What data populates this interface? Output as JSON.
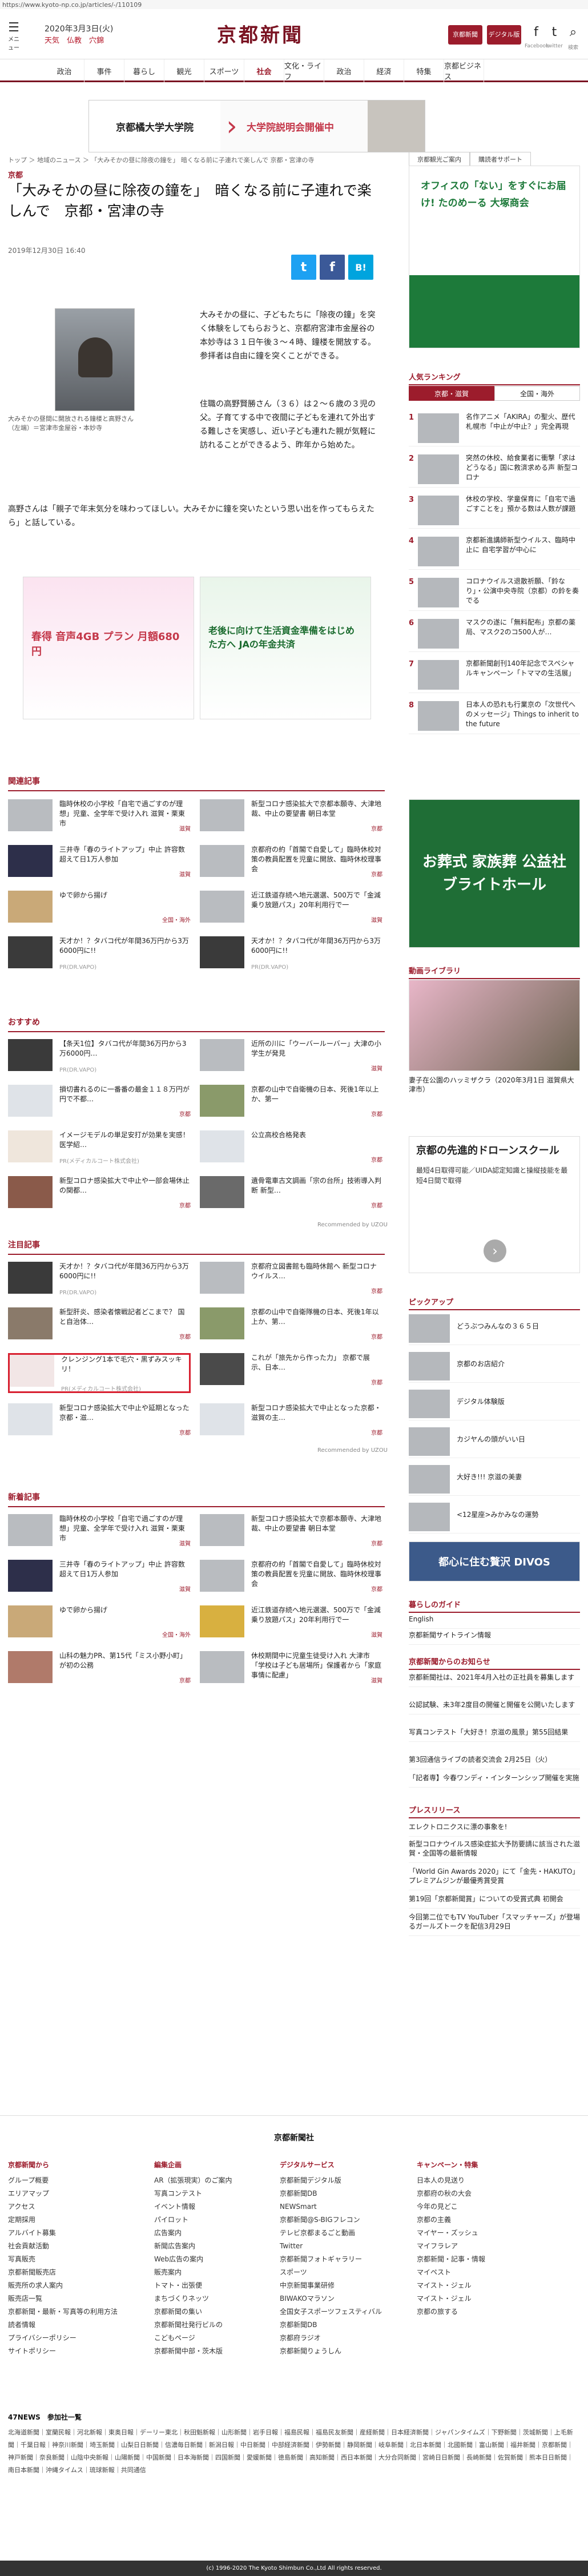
{
  "url": "https://www.kyoto-np.co.jp/articles/-/110109",
  "header": {
    "menu_label": "メニュー",
    "date": "2020年3月3日(火)",
    "weather": "天気　仏教　穴錦",
    "logo": "京都新聞",
    "member_label": "京都新聞",
    "digital_label": "デジタル版",
    "facebook_label": "Facebook",
    "twitter_label": "twitter",
    "search_label": "検索"
  },
  "nav": [
    "政治",
    "事件",
    "暮らし",
    "観光",
    "スポーツ",
    "社会",
    "文化・ライフ",
    "政治",
    "経済",
    "特集",
    "京都ビジネス"
  ],
  "banner": {
    "left": "京都橘大学大学院",
    "right": "大学院説明会開催中"
  },
  "breadcrumb": "トップ ＞ 地域のニュース ＞ 「大みそかの昼に除夜の鐘を」 暗くなる前に子連れで楽しんで 京都・宮津の寺",
  "side_tabs": [
    "京都観光ご案内",
    "購読者サポート"
  ],
  "article": {
    "section": "京都",
    "title": "「大みそかの昼に除夜の鐘を」　暗くなる前に子連れで楽しんで　京都・宮津の寺",
    "date": "2019年12月30日 16:40",
    "photo_caption": "大みそかの昼間に開放される鐘楼と高野さん（左端）＝宮津市金屋谷・本妙寺",
    "p1": "大みそかの昼に、子どもたちに「除夜の鐘」を突く体験をしてもらおうと、京都府宮津市金屋谷の本妙寺は３１日午後３〜４時、鐘楼を開放する。参拝者は自由に鐘を突くことができる。",
    "p2": "住職の高野賢勝さん（３６）は２〜６歳の３児の父。子育てする中で夜間に子どもを連れて外出する難しさを実感し、近い子ども連れた親が気軽に訪れることができるよう、昨年から始めた。",
    "p3": "高野さんは「親子で年末気分を味わってほしい。大みそかに鐘を突いたという思い出を作ってもらえたら」と話している。",
    "ad_left": "春得 音声4GB プラン 月額680円",
    "ad_right": "老後に向けて生活資金準備をはじめた方へ JAの年金共済"
  },
  "related": {
    "title": "関連記事",
    "items": [
      {
        "text": "臨時休校の小学校「自宅で過ごすのが理想」児童、全学年で受け入れ 滋賀・栗東市",
        "tag": "滋賀"
      },
      {
        "text": "新型コロナ感染拡大で京都本願寺、大津地裁、中止の要望書 朝日本堂",
        "tag": "京都"
      },
      {
        "text": "三井寺「春のライトアップ」中止 許容数超えて日1万人参加",
        "tag": "滋賀"
      },
      {
        "text": "京都府の約「首閣で自愛して」臨時休校対策の教員配置を児童に開放、臨時休校理事会",
        "tag": "京都"
      },
      {
        "text": "ゆで卵から揚げ",
        "tag": "全国・海外"
      },
      {
        "text": "近江鉄道存続へ地元選選、500万で「金減乗り放題パス」20年利用行で一",
        "tag": "滋賀"
      },
      {
        "text": "天才か！？タバコ代が年間36万円から3万6000円に!!",
        "tag": "PR(DR.VAPO)"
      },
      {
        "text": "天才か！？タバコ代が年間36万円から3万6000円に!!",
        "tag": "PR(DR.VAPO)"
      }
    ]
  },
  "recommend": {
    "title": "おすすめ",
    "items": [
      {
        "text": "【条天1位】タバコ代が年間36万円から3万6000円…",
        "tag": "PR(DR.VAPO)"
      },
      {
        "text": "近所の川に「ウーバールーバー」大津の小学生が発見",
        "tag": "滋賀"
      },
      {
        "text": "損切書れるのに一番番の最金１１８万円が円で不都…",
        "tag": "京都"
      },
      {
        "text": "京都の山中で自衛機の日本、死後1年以上か、第一",
        "tag": "京都"
      },
      {
        "text": "イメージモデルの単足安打が効果を実感！医学紹…",
        "tag": "PR(メディカルコート株式会社)"
      },
      {
        "text": "公立高校合格発表",
        "tag": "京都"
      },
      {
        "text": "新型コロナ感染拡大で中止や一部会場休止の関都…",
        "tag": "京都"
      },
      {
        "text": "遺骨電車古文調画「宗の台所」技術導入判断 新型…",
        "tag": "京都"
      }
    ],
    "recommended_by": "Recommended by UZOU"
  },
  "featured": {
    "title": "注目記事",
    "items": [
      {
        "text": "天才か！？タバコ代が年間36万円から3万6000円に!!",
        "tag": "PR(DR.VAPO)"
      },
      {
        "text": "京都府立図書館も臨時休館へ 新型コロナウイルス…",
        "tag": "京都"
      },
      {
        "text": "新型肝炎、感染者懐戦記者どこまで？ 国と自治体…",
        "tag": "京都"
      },
      {
        "text": "京都の山中で自衛隊機の日本、死後1年以上か、第…",
        "tag": "京都"
      },
      {
        "text": "クレンジング1本で毛穴・黒ずみスッキリ！",
        "tag": "PR(メディカルコート株式会社)"
      },
      {
        "text": "これが「旅先から作った力」 京都で展示、日本…",
        "tag": "京都"
      },
      {
        "text": "新型コロナ感染拡大で中止や延期となった京都・滋…",
        "tag": "京都"
      },
      {
        "text": "新型コロナ感染拡大で中止となった京都・滋賀の主…",
        "tag": "京都"
      }
    ],
    "recommended_by": "Recommended by UZOU"
  },
  "latest": {
    "title": "新着記事",
    "items": [
      {
        "text": "臨時休校の小学校「自宅で過ごすのが理想」児童、全学年で受け入れ 滋賀・栗東市",
        "tag": "滋賀"
      },
      {
        "text": "新型コロナ感染拡大で京都本願寺、大津地裁、中止の要望書 朝日本堂",
        "tag": "京都"
      },
      {
        "text": "三井寺「春のライトアップ」中止 許容数超えて日1万人参加",
        "tag": "滋賀"
      },
      {
        "text": "京都府の約「首閣で自愛して」臨時休校対策の教員配置を児童に開放、臨時休校理事会",
        "tag": "京都"
      },
      {
        "text": "ゆで卵から揚げ",
        "tag": "全国・海外"
      },
      {
        "text": "近江鉄道存続へ地元選選、500万で「金減乗り放題パス」20年利用行で一",
        "tag": "滋賀"
      },
      {
        "text": "山科の魅力PR、第15代「ミス小野小町」が初の公務",
        "tag": "京都"
      },
      {
        "text": "休校期間中に児童生徒受け入れ 大津市「学校は子ども居場所」保護者から「家庭事情に配慮」",
        "tag": "滋賀"
      }
    ]
  },
  "sidebar": {
    "ad_top": "オフィスの「ない」をすぐにお届け! たのめーる 大塚商会",
    "ranking_title": "人気ランキング",
    "ranking_tabs": [
      "京都・滋賀",
      "全国・海外"
    ],
    "ranking": [
      {
        "n": "1",
        "text": "名作アニメ「AKIRA」の聖火、歴代札幌市「中止が中止？」完全再現"
      },
      {
        "n": "2",
        "text": "突然の休校、給食業者に衝撃「求はどうなる」国に救済求める声 新型コロナ"
      },
      {
        "n": "3",
        "text": "休校の学校、学童保育に「自宅で過ごすことを」預かる数は人数が課題"
      },
      {
        "n": "4",
        "text": "京都新進講師新型ウイルス、臨時中止に 自宅学習が中心に"
      },
      {
        "n": "5",
        "text": "コロナウイルス退散祈願、「鈴なり」・公演中央寺院（京都）の鈴を奏でる"
      },
      {
        "n": "6",
        "text": "マスクの遂に「無料配布」京都の薬局、マスク2のコ500人が…"
      },
      {
        "n": "7",
        "text": "京都新聞創刊140年記念でスペシャルキャンペーン「トママの生活展」"
      },
      {
        "n": "8",
        "text": "日本人の恐れも行業京の「次世代へのメッセージ」Things to inherit to the future"
      }
    ],
    "ad_mid": "お葬式 家族葬 公益社 ブライトホール",
    "video_title": "動画ライブラリ",
    "video_caption": "妻子在公園のハッミザクラ（2020年3月1日 滋賀県大津市）",
    "drone_title": "京都の先進的ドローンスクール",
    "drone_text": "最短4日取得可能／UIDA認定知識と操縦技能を最短4日間で取得",
    "pickup_title": "ピックアップ",
    "pickup": [
      "どうぶつみんなの３６５日",
      "京都のお店紹介",
      "デジタル体験版",
      "カジヤんの頭がいい日",
      "大好き!!! 京滋の美妻",
      "<12星座>みかみなの運勢"
    ],
    "pickup_ad": "都心に住む贅沢 DIVOS",
    "guide_title": "暮らしのガイド",
    "guide": [
      "English",
      "京都新聞サイトライン情報"
    ],
    "notice_title": "京都新聞からのお知らせ",
    "notices": [
      "京都新聞社は、2021年4月入社の正社員を募集します",
      "公認試験、未3年2度目の開催と開催を公開いたします",
      "写真コンテスト「大好き！京滋の風景」第55回結果",
      "第3回通信ライブの読者交流会 2月25日（火）",
      "「記者専】今春ワンディ・インターンシップ開催を実施"
    ],
    "press_title": "プレスリリース",
    "press": [
      "エレクトロニクスに漂の事象を!",
      "新型コロナウイルス感染症拡大予防要請に該当された滋賀・全国等の最新情報",
      "「World Gin Awards 2020」にて「金先・HAKUTO」プレミアムジンが最優秀賞受賞",
      "第19回「京都新聞賞」についての受賞式典 初開会",
      "今回第二位でもTV YouTuber「スマッチャーズ」が登場るガールズトークを配信3月29日"
    ]
  },
  "footer": {
    "logo": "京都新聞社",
    "cols": [
      {
        "h": "京都新聞から",
        "items": [
          "グループ概要",
          "エリアマップ",
          "アクセス",
          "定期採用",
          "アルバイト募集",
          "社会貢献活動",
          "写真販売",
          "京都新聞販売店",
          "販売所の求人案内",
          "販売店一覧",
          "京都新聞・最新・写真等の利用方法",
          "読者情報",
          "プライバシーポリシー",
          "サイトポリシー"
        ]
      },
      {
        "h": "編集企画",
        "items": [
          "AR（拡張現実）のご案内",
          "写真コンテスト",
          "イベント情報",
          "パイロット",
          "広告案内",
          "新聞広告案内",
          "Web広告の案内",
          "販売案内",
          "トマト・出張便",
          "まちづくりネッツ",
          "京都新聞の集い",
          "京都新聞社発行ビルの",
          "こどもページ",
          "京都新聞中部・茨木版"
        ]
      },
      {
        "h": "デジタルサービス",
        "items": [
          "京都新聞デジタル版",
          "京都新聞DB",
          "NEWSmart",
          "京都新聞@S-BIGフレコン",
          "テレビ京都まるごと動画",
          "Twitter",
          "京都新聞フォトギャラリー",
          "スポーツ",
          "中京新聞事業研修",
          "BIWAKOマラソン",
          "全国女子スポーツフェスティバル",
          "京都新聞DB",
          "京都府ラジオ",
          "京都新聞りょうしん"
        ]
      },
      {
        "h": "キャンペーン・特集",
        "items": [
          "日本人の見送り",
          "京都府の秋の大会",
          "今年の見どこ",
          "京都の主義",
          "マイヤー・ズッシュ",
          "マイフラレア",
          "京都新聞・記事・情報",
          "マイペスト",
          "マイスト・ジェル",
          "マイスト・ジェル",
          "京都の旅する"
        ]
      }
    ],
    "news_title": "47NEWS　参加社一覧",
    "news": "北海道新聞｜室蘭民報｜河北新報｜東奥日報｜デーリー東北｜秋田魁新報｜山形新聞｜岩手日報｜福島民報｜福島民友新聞｜産経新聞｜日本経済新聞｜ジャパンタイムズ｜下野新聞｜茨城新聞｜上毛新聞｜千葉日報｜神奈川新聞｜埼玉新聞｜山梨日日新聞｜信濃毎日新聞｜新潟日報｜中日新聞｜中部経済新聞｜伊勢新聞｜静岡新聞｜岐阜新聞｜北日本新聞｜北國新聞｜富山新聞｜福井新聞｜京都新聞｜神戸新聞｜奈良新聞｜山陰中央新報｜山陽新聞｜中国新聞｜日本海新聞｜四国新聞｜愛媛新聞｜徳島新聞｜高知新聞｜西日本新聞｜大分合同新聞｜宮崎日日新聞｜長崎新聞｜佐賀新聞｜熊本日日新聞｜南日本新聞｜沖縄タイムス｜琉球新報｜共同通信",
    "copyright": "(c) 1996-2020 The Kyoto Shimbun Co.,Ltd All rights reserved."
  }
}
